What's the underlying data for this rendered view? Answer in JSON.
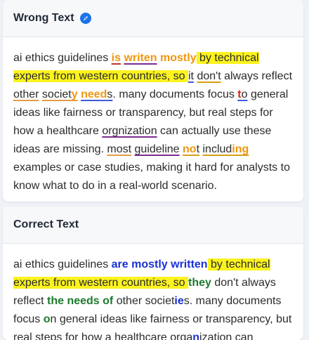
{
  "wrong": {
    "title": "Wrong Text",
    "icon": "compass-icon",
    "segments": {
      "s1": "ai ethics guidelines ",
      "s2": "is",
      "s3": " ",
      "s4": "writen",
      "s5": " ",
      "s6": "mostly",
      "s7": "  by technical experts from western countries, so  ",
      "s8": "it",
      "s9": " ",
      "s10": "don't",
      "s11": " always reflect ",
      "s12": "other",
      "s13": " ",
      "s14a": "societ",
      "s14b": "y",
      "s15": " ",
      "s16a": "need",
      "s16b": "s",
      "s17": ". many documents focus ",
      "s18": "t",
      "s19": "o",
      "s20": " general ideas like fairness or transparency, but real steps for how a healthcare ",
      "s21": "orgnization",
      "s22": " can actually use these ideas are missing. ",
      "s23": "most",
      "s24": " ",
      "s25": "guideline",
      "s26": " ",
      "s27a": "no",
      "s27b": "t",
      "s28": " ",
      "s29a": "includ",
      "s29b": "ing",
      "s30": " examples or case studies, making it hard for analysts to know what to do in a real-world scenario."
    }
  },
  "correct": {
    "title": "Correct Text",
    "segments": {
      "c1": "ai ethics guidelines ",
      "c2": "are mostly written",
      "c3": "  by technical experts from western countries, so ",
      "c4": "they",
      "c5": " don't always reflect ",
      "c6": "the needs of",
      "c7": " other societ",
      "c8": "ie",
      "c9": "s. many documents focus ",
      "c10": "o",
      "c11": "n general ideas like fairness or transparency, but real steps for how a healthcare orga",
      "c12": "n",
      "c13": "ization can"
    }
  },
  "colors": {
    "highlight": "#fbf31e",
    "error_orange": "#f0960e",
    "error_red": "#d9261c",
    "fix_blue": "#1a2fd6",
    "fix_green": "#1d7a2e"
  }
}
